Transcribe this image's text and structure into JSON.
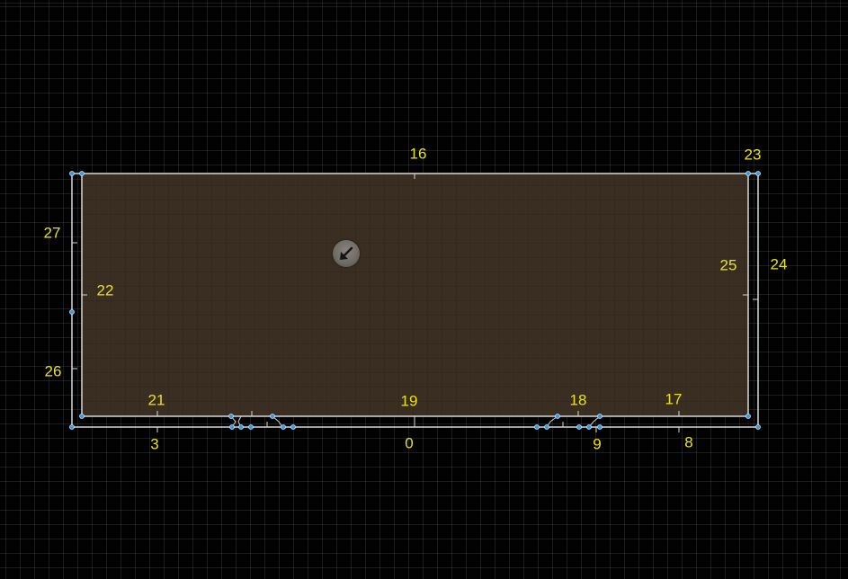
{
  "viewport": {
    "name": "level-editor-viewport",
    "grid_visible": true
  },
  "colors": {
    "background": "#020202",
    "grid": "#3a3a3a",
    "floor": "#3a2e22",
    "wall_line": "#d8d8d8",
    "vertex_handle": "#3a9bdc",
    "label": "#e8e21a"
  },
  "spawn": {
    "icon": "arrow-down-left-icon"
  },
  "labels": {
    "l0": "0",
    "l3": "3",
    "l8": "8",
    "l9": "9",
    "l16": "16",
    "l17": "17",
    "l18": "18",
    "l19": "19",
    "l21": "21",
    "l22": "22",
    "l23": "23",
    "l24": "24",
    "l25": "25",
    "l26": "26",
    "l27": "27"
  }
}
